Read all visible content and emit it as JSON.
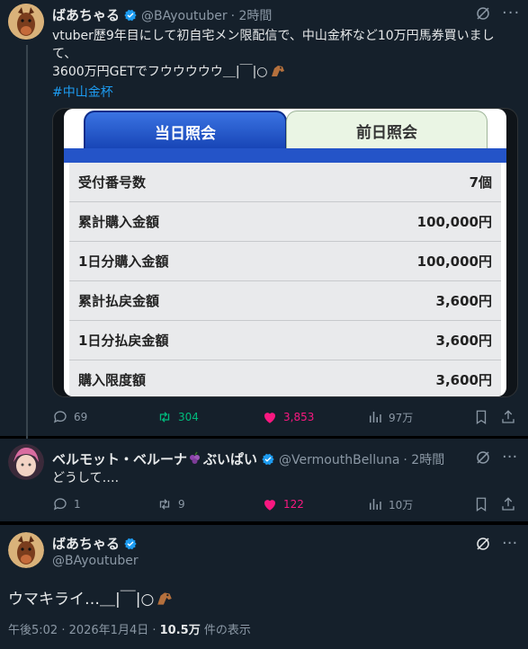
{
  "post1": {
    "display_name": "ばあちゃる",
    "handle": "@BAyoutuber",
    "time": "· 2時間",
    "text_line1": "vtuber歴9年目にして初自宅メン限配信で、中山金杯など10万円馬券買いまし",
    "text_line2": "て、",
    "text_line3": "3600万円GETでフウウウウウ＿|￣|○",
    "hashtag": "#中山金杯",
    "card": {
      "tab_active": "当日照会",
      "tab_inactive": "前日照会",
      "rows": [
        {
          "label": "受付番号数",
          "value": "7個"
        },
        {
          "label": "累計購入金額",
          "value": "100,000円"
        },
        {
          "label": "1日分購入金額",
          "value": "100,000円"
        },
        {
          "label": "累計払戻金額",
          "value": "3,600円"
        },
        {
          "label": "1日分払戻金額",
          "value": "3,600円"
        },
        {
          "label": "購入限度額",
          "value": "3,600円"
        }
      ]
    },
    "actions": {
      "replies": "69",
      "reposts": "304",
      "likes": "3,853",
      "views": "97万"
    }
  },
  "post2": {
    "display_name": "ベルモット・ベルーナ",
    "name_suffix": "ぶいぱい",
    "handle": "@VermouthBelluna",
    "time": "· 2時間",
    "text": "どうして….",
    "actions": {
      "replies": "1",
      "reposts": "9",
      "likes": "122",
      "views": "10万"
    }
  },
  "post3": {
    "display_name": "ばあちゃる",
    "handle": "@BAyoutuber",
    "text": "ウマキライ…＿|￣|○",
    "time": "午後5:02 · 2026年1月4日 · ",
    "views_count": "10.5万",
    "views_suffix": " 件の表示"
  },
  "colors": {
    "accent": "#1d9bf0",
    "repost": "#00ba7c",
    "like": "#f91880",
    "bg": "#15202b"
  }
}
